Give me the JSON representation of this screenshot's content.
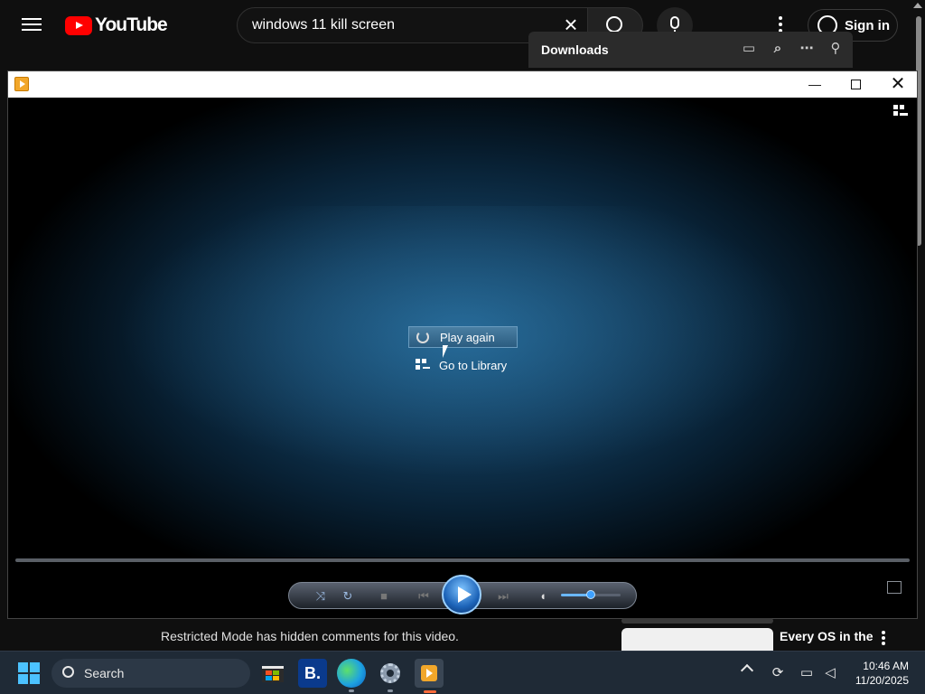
{
  "youtube": {
    "logo_text": "YouTube",
    "search_value": "windows 11 kill screen",
    "signin_label": "Sign in",
    "restricted_notice": "Restricted Mode has hidden comments for this video.",
    "recommended_title": "Every OS in the"
  },
  "downloads": {
    "title": "Downloads",
    "icons": [
      "folder-icon",
      "search-icon",
      "more-icon",
      "pin-icon"
    ]
  },
  "player": {
    "window_buttons": {
      "minimize": "—",
      "close": "✕"
    },
    "menu": {
      "play_again": "Play again",
      "go_to_library": "Go to Library"
    },
    "volume_level": 0.5,
    "colors": {
      "accent": "#3ea0ff",
      "play_button": "#1c63b8"
    }
  },
  "taskbar": {
    "search_placeholder": "Search",
    "booking_label": "B.",
    "clock_time": "10:46 AM",
    "clock_date": "11/20/2025",
    "apps": [
      "microsoft-store-icon",
      "booking-icon",
      "edge-icon",
      "settings-icon",
      "media-player-icon"
    ]
  }
}
